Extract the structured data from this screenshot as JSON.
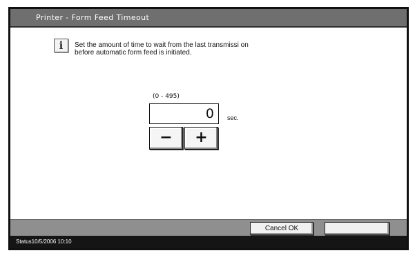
{
  "window": {
    "title": "Printer - Form Feed Timeout"
  },
  "info": {
    "icon": "info-icon",
    "icon_glyph": "i",
    "message_line1": "Set the amount of time to wait from the last transmissi on",
    "message_line2": "before automatic form feed is initiated."
  },
  "timeout": {
    "range_label": "(0 - 495)",
    "value": "0",
    "unit": "sec."
  },
  "stepper": {
    "decrement_label": "−",
    "increment_label": "+"
  },
  "footer": {
    "cancel_ok_label": "Cancel OK",
    "blank_label": ""
  },
  "status": {
    "text": "Status10/5/2006    10:10"
  },
  "colors": {
    "titlebar": "#6f6f6f",
    "footer": "#8f8f8f",
    "statusbar": "#151515"
  }
}
